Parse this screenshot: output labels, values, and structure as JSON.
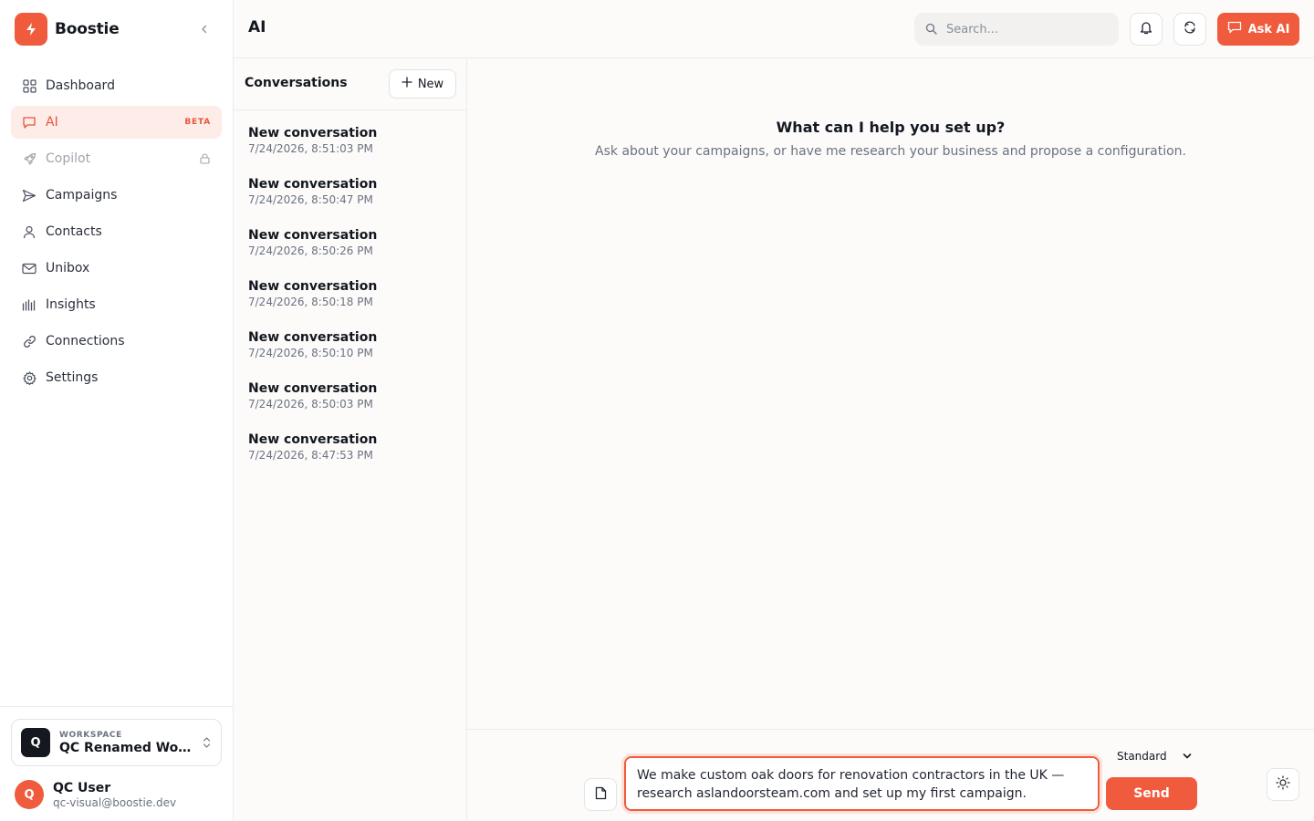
{
  "brand": {
    "name": "Boostie",
    "logo_icon": "bolt-icon",
    "accent": "#f05a3d"
  },
  "sidebar": {
    "items": [
      {
        "label": "Dashboard",
        "icon": "grid-icon",
        "state": "normal"
      },
      {
        "label": "AI",
        "icon": "chat-icon",
        "state": "active",
        "badge": "BETA"
      },
      {
        "label": "Copilot",
        "icon": "rocket-icon",
        "state": "disabled",
        "locked": true
      },
      {
        "label": "Campaigns",
        "icon": "send-icon",
        "state": "normal"
      },
      {
        "label": "Contacts",
        "icon": "user-icon",
        "state": "normal"
      },
      {
        "label": "Unibox",
        "icon": "mail-icon",
        "state": "normal"
      },
      {
        "label": "Insights",
        "icon": "bars-icon",
        "state": "normal"
      },
      {
        "label": "Connections",
        "icon": "link-icon",
        "state": "normal"
      },
      {
        "label": "Settings",
        "icon": "gear-icon",
        "state": "normal"
      }
    ],
    "workspace": {
      "caption": "WORKSPACE",
      "initial": "Q",
      "name": "QC Renamed Workspace"
    },
    "user": {
      "initial": "Q",
      "name": "QC User",
      "email": "qc-visual@boostie.dev"
    }
  },
  "header": {
    "title": "AI",
    "search_placeholder": "Search...",
    "ask_ai_label": "Ask AI"
  },
  "conversations": {
    "title": "Conversations",
    "new_label": "New",
    "items": [
      {
        "name": "New conversation",
        "date": "7/24/2026, 8:51:03 PM"
      },
      {
        "name": "New conversation",
        "date": "7/24/2026, 8:50:47 PM"
      },
      {
        "name": "New conversation",
        "date": "7/24/2026, 8:50:26 PM"
      },
      {
        "name": "New conversation",
        "date": "7/24/2026, 8:50:18 PM"
      },
      {
        "name": "New conversation",
        "date": "7/24/2026, 8:50:10 PM"
      },
      {
        "name": "New conversation",
        "date": "7/24/2026, 8:50:03 PM"
      },
      {
        "name": "New conversation",
        "date": "7/24/2026, 8:47:53 PM"
      }
    ]
  },
  "chat": {
    "empty_title": "What can I help you set up?",
    "empty_subtitle": "Ask about your campaigns, or have me research your business and propose a configuration.",
    "input_value": "We make custom oak doors for renovation contractors in the UK — research aslandoorsteam.com and set up my first campaign.",
    "mode_selected": "Standard",
    "send_label": "Send"
  }
}
